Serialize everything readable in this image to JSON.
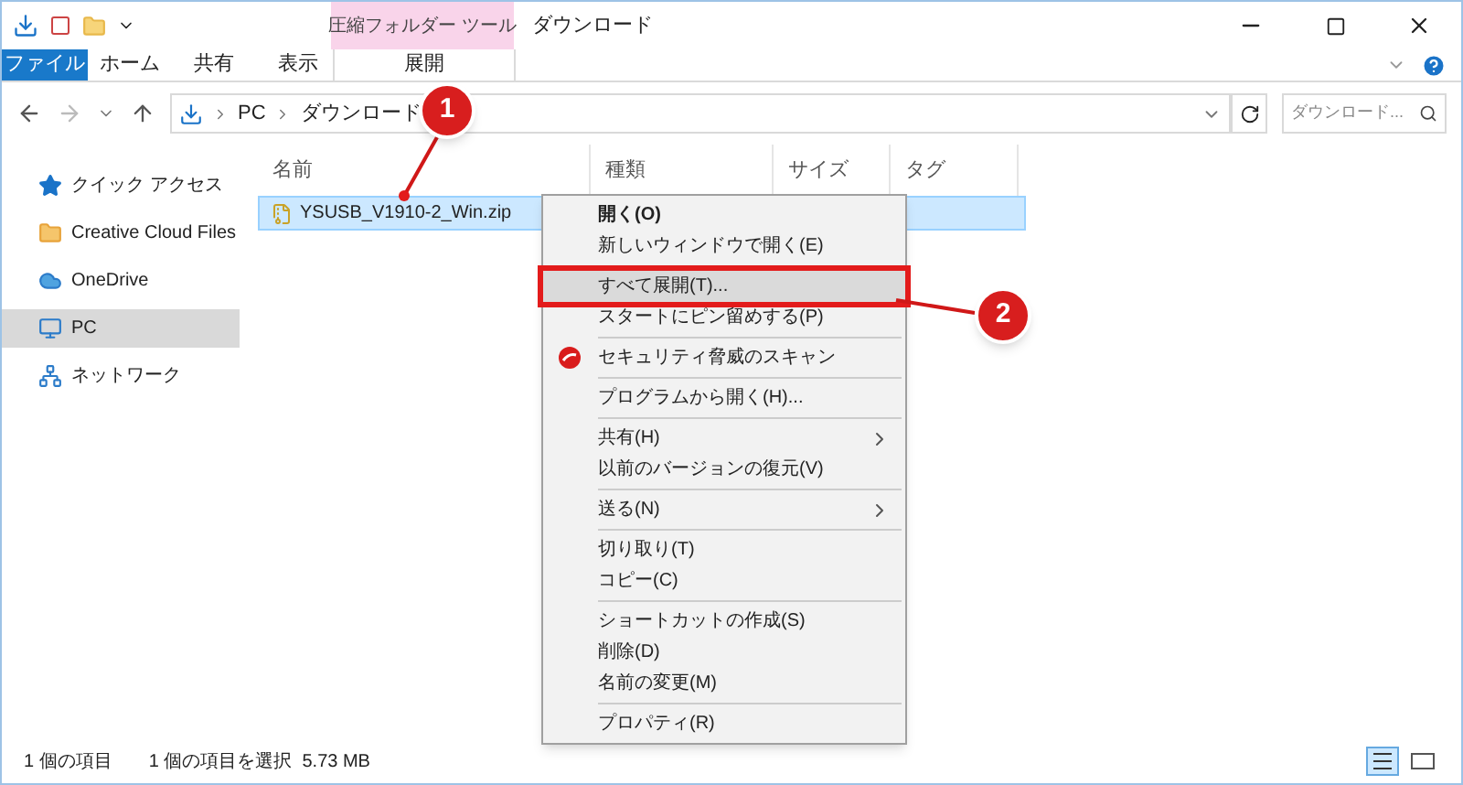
{
  "window": {
    "title": "ダウンロード",
    "context_tab_group": "圧縮フォルダー ツール"
  },
  "ribbon_tabs": [
    {
      "label": "ファイル",
      "kind": "file",
      "selected": false
    },
    {
      "label": "ホーム",
      "kind": "tab",
      "selected": false
    },
    {
      "label": "共有",
      "kind": "tab",
      "selected": false
    },
    {
      "label": "表示",
      "kind": "tab",
      "selected": false
    },
    {
      "label": "展開",
      "kind": "context",
      "selected": false
    }
  ],
  "address": {
    "segments": [
      "PC",
      "ダウンロード"
    ],
    "search_placeholder": "ダウンロード..."
  },
  "sidebar": {
    "items": [
      {
        "label": "クイック アクセス",
        "selected": false
      },
      {
        "label": "Creative Cloud Files",
        "selected": false
      },
      {
        "label": "OneDrive",
        "selected": false
      },
      {
        "label": "PC",
        "selected": true
      },
      {
        "label": "ネットワーク",
        "selected": false
      }
    ]
  },
  "table": {
    "columns": [
      "名前",
      "種類",
      "サイズ",
      "タグ"
    ],
    "rows": [
      {
        "name": "YSUSB_V1910-2_Win.zip",
        "selected": true
      }
    ]
  },
  "context_menu": {
    "items": [
      {
        "kind": "item",
        "label": "開く(O)",
        "bold": true,
        "selected": false
      },
      {
        "kind": "item",
        "label": "新しいウィンドウで開く(E)",
        "bold": false,
        "selected": false
      },
      {
        "kind": "separator"
      },
      {
        "kind": "item",
        "label": "すべて展開(T)...",
        "bold": false,
        "selected": true
      },
      {
        "kind": "item",
        "label": "スタートにピン留めする(P)",
        "bold": false,
        "selected": false
      },
      {
        "kind": "separator"
      },
      {
        "kind": "scan_item",
        "label": "セキュリティ脅威のスキャン",
        "bold": false,
        "selected": false
      },
      {
        "kind": "separator"
      },
      {
        "kind": "item",
        "label": "プログラムから開く(H)...",
        "bold": false,
        "selected": false
      },
      {
        "kind": "separator"
      },
      {
        "kind": "item",
        "label": "共有(H)",
        "bold": false,
        "selected": false,
        "submenu": true
      },
      {
        "kind": "item",
        "label": "以前のバージョンの復元(V)",
        "bold": false,
        "selected": false
      },
      {
        "kind": "separator"
      },
      {
        "kind": "item",
        "label": "送る(N)",
        "bold": false,
        "selected": false,
        "submenu": true
      },
      {
        "kind": "separator"
      },
      {
        "kind": "item",
        "label": "切り取り(T)",
        "bold": false,
        "selected": false
      },
      {
        "kind": "item",
        "label": "コピー(C)",
        "bold": false,
        "selected": false
      },
      {
        "kind": "separator"
      },
      {
        "kind": "item",
        "label": "ショートカットの作成(S)",
        "bold": false,
        "selected": false
      },
      {
        "kind": "item",
        "label": "削除(D)",
        "bold": false,
        "selected": false
      },
      {
        "kind": "item",
        "label": "名前の変更(M)",
        "bold": false,
        "selected": false
      },
      {
        "kind": "separator"
      },
      {
        "kind": "item",
        "label": "プロパティ(R)",
        "bold": false,
        "selected": false
      }
    ]
  },
  "status_bar": {
    "count": "1 個の項目",
    "selection": "1 個の項目を選択  5.73 MB"
  },
  "callouts": [
    {
      "number": "1"
    },
    {
      "number": "2"
    }
  ]
}
